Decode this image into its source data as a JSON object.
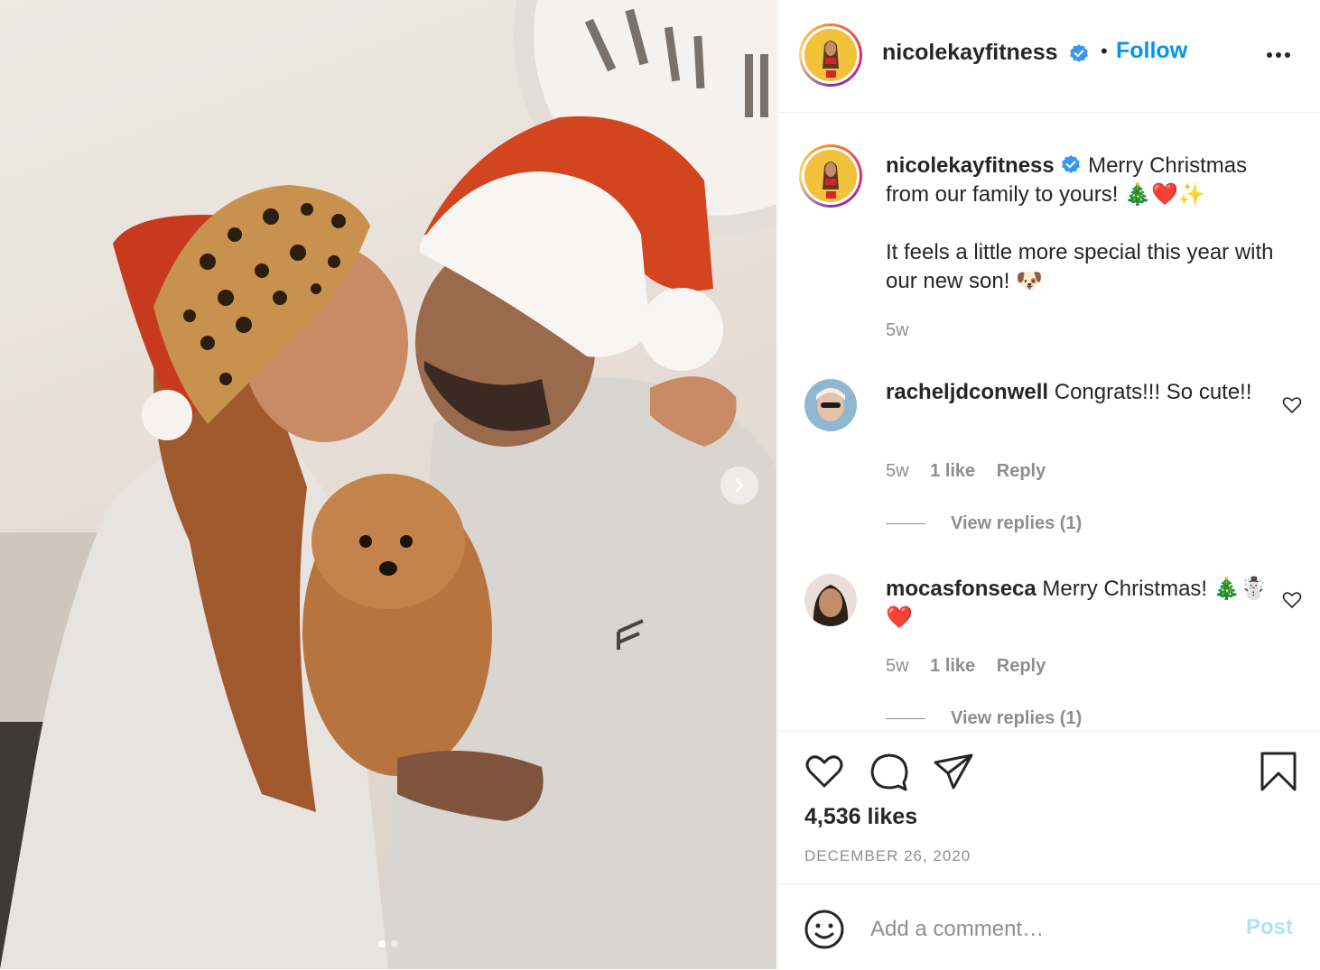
{
  "post": {
    "author": "nicolekayfitness",
    "follow_label": "Follow",
    "separator": "•",
    "photo_carousel": {
      "total": 2,
      "active_index": 0
    }
  },
  "caption": {
    "username": "nicolekayfitness",
    "line1": "Merry Christmas from our family to yours! 🎄❤️✨",
    "line2": "It feels a little more special this year with our new son! 🐶",
    "time": "5w"
  },
  "comments": [
    {
      "username": "racheljdconwell",
      "text": "Congrats!!! So cute!!",
      "time": "5w",
      "likes": "1 like",
      "reply_label": "Reply",
      "view_replies": "View replies (1)"
    },
    {
      "username": "mocasfonseca",
      "text": "Merry Christmas! 🎄☃️❤️",
      "time": "5w",
      "likes": "1 like",
      "reply_label": "Reply",
      "view_replies": "View replies (1)"
    }
  ],
  "stats": {
    "likes": "4,536 likes",
    "date": "DECEMBER 26, 2020"
  },
  "add_comment": {
    "placeholder": "Add a comment…",
    "post_label": "Post"
  },
  "colors": {
    "link_blue": "#0095f6",
    "post_disabled": "#b2dffc",
    "muted": "#8e8e8e",
    "verified": "#3897f0"
  },
  "icons": [
    "verified-badge-icon",
    "more-options-icon",
    "chevron-right-icon",
    "heart-icon",
    "comment-icon",
    "share-icon",
    "bookmark-icon",
    "emoji-icon"
  ]
}
